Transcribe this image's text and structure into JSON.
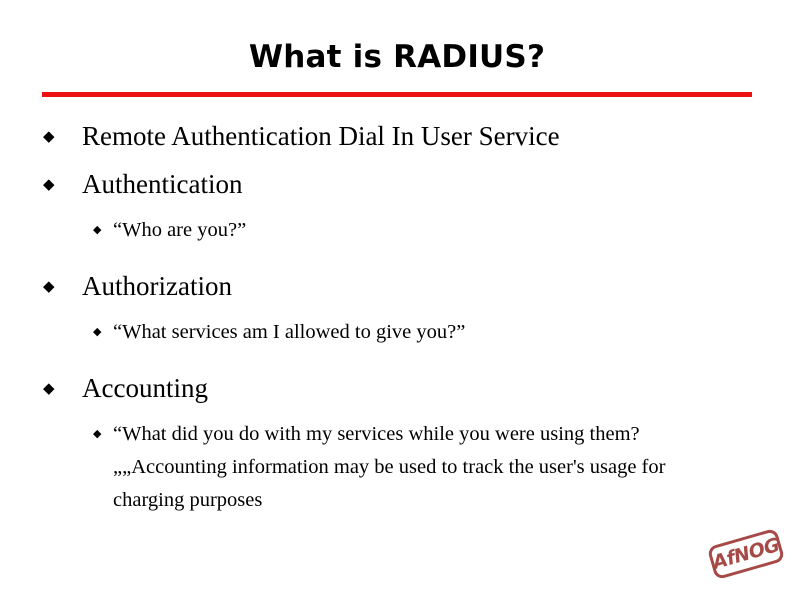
{
  "slide": {
    "title": "What is RADIUS?",
    "accent_color": "#ee1111",
    "background_color": "#ffffff",
    "text_color": "#000000",
    "bullet_glyph": "◆",
    "bullets": [
      {
        "level": 1,
        "text": "Remote Authentication Dial In User Service"
      },
      {
        "level": 1,
        "text": "Authentication"
      },
      {
        "level": 2,
        "text": "“Who are you?”"
      },
      {
        "level": 1,
        "text": "Authorization"
      },
      {
        "level": 2,
        "text": "“What services am I allowed to give you?”"
      },
      {
        "level": 1,
        "text": "Accounting"
      },
      {
        "level": 2,
        "text": "“What did you do with my services while you were using them?„„Accounting information may be used to track the user's usage for charging purposes"
      }
    ]
  },
  "logo": {
    "text": "AfNOG",
    "color": "#9e3b38"
  }
}
